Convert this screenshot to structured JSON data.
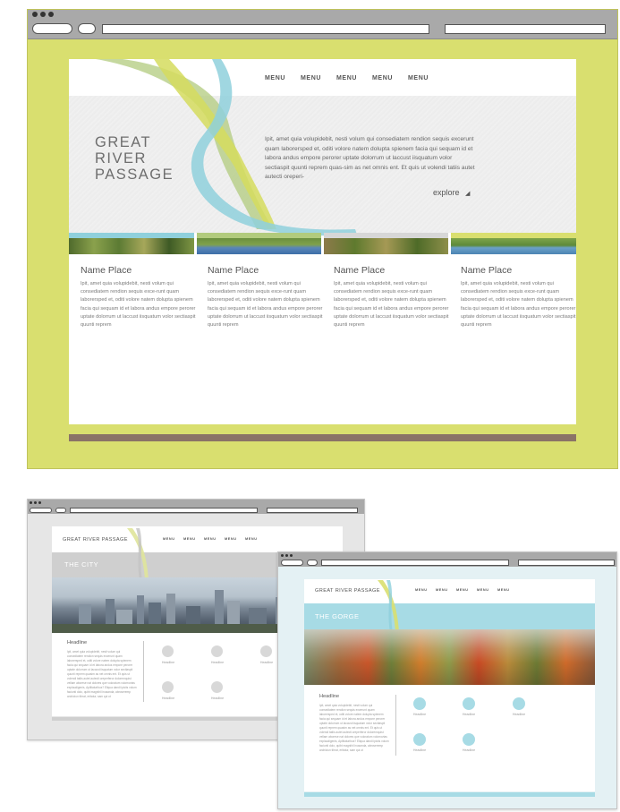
{
  "main": {
    "logo": {
      "line1": "GREAT",
      "line2": "RIVER",
      "line3": "PASSAGE"
    },
    "menu": [
      "MENU",
      "MENU",
      "MENU",
      "MENU",
      "MENU"
    ],
    "hero_text": "Ipit, amet quia volupidebit, nesti volum qui consediatem rendion sequis excerunt quam laborersped et, oditi volore natem dolupta spienem facia qui sequam id et labora andus empore perorer uptate dolorrum ut laccust iisquatum volor sectiaspit quunti reprem quas-sim as net omnis ent. Et quis ut volendi tatiis autet autecti oreperi-",
    "explore": "explore",
    "cards": [
      {
        "title": "Name Place",
        "text": "Ipit, amet quia volupidebit, nesti volum qui consediatem rendion sequis exce-runt quam laborersped et, oditi volore natem dolupta spienem facia qui sequam id et labora andus empore perorer uptate dolorrum ut laccust iisquatum volor sectiaspit quunti reprem"
      },
      {
        "title": "Name Place",
        "text": "Ipit, amet quia volupidebit, nesti volum qui consediatem rendion sequis exce-runt quam laborersped et, oditi volore natem dolupta spienem facia qui sequam id et labora andus empore perorer uptate dolorrum ut laccust iisquatum volor sectiaspit quunti reprem"
      },
      {
        "title": "Name Place",
        "text": "Ipit, amet quia volupidebit, nesti volum qui consediatem rendion sequis exce-runt quam laborersped et, oditi volore natem dolupta spienem facia qui sequam id et labora andus empore perorer uptate dolorrum ut laccust iisquatum volor sectiaspit quunti reprem"
      },
      {
        "title": "Name Place",
        "text": "Ipit, amet quia volupidebit, nesti volum qui consediatem rendion sequis exce-runt quam laborersped et, oditi volore natem dolupta spienem facia qui sequam id et labora andus empore perorer uptate dolorrum ut laccust iisquatum volor sectiaspit quunti reprem"
      }
    ]
  },
  "city": {
    "logo": "GREAT RIVER PASSAGE",
    "menu": [
      "MENU",
      "MENU",
      "MENU",
      "MENU",
      "MENU"
    ],
    "banner": "THE CITY",
    "headline": "Headline",
    "body": "Ipit, amet quia volupidebit, nesti volum qui consediatem rendion sequis excerunt quam laborersped et, oditi volore natem dolupta spienem facia qui sequam id et labora andus empore perorer uptate dolorrum ut laccust iisquatum volor sectiaspit quunti reprem quasim as net omnis ent. Et quis ut volendi tatiis autet autecti oreperferor doloremquist vellam aborese nat dolores que voloratum volorrovtas explaudigenis, Aplitiaturibus? Eliqua dandi ipiciis volum faciunti dolo, quibt magnihil inusanda, abroseremp archiciun tibrat, eritatur, sam qui ut",
    "circle_labels": [
      "Headline",
      "Headline",
      "Headline",
      "Headline",
      "Headline"
    ]
  },
  "gorge": {
    "logo": "GREAT RIVER PASSAGE",
    "menu": [
      "MENU",
      "MENU",
      "MENU",
      "MENU",
      "MENU"
    ],
    "banner": "THE GORGE",
    "headline": "Headline",
    "body": "Ipit, amet quia volupidebit, nesti volum qui consediatem rendion sequis excerunt quam laborersped et, oditi volore natem dolupta spienem facia qui sequam id et labora andus empore perorer uptate dolorrum ut laccust iisquatum volor sectiaspit quunti reprem quasim as net omnis ent. Et quis ut volendi tatiis autet autecti oreperferor doloremquist vellam aborese nat dolores que voloratum volorrovtas explaudigenis, Aplitiaturibus? Eliqua dandi ipiciis volum faciunti dolo, quibt magnihil inusanda, abroseremp archiciun tibrat, eritatur, sam qui ut",
    "circle_labels": [
      "Headline",
      "Headline",
      "Headline",
      "Headline",
      "Headline"
    ]
  },
  "colors": {
    "frame_yellow": "#d9df6f",
    "river_blue": "#8fd0dc",
    "river_green": "#b2cb7d",
    "footer_brown": "#8a7367",
    "city_gray": "#cfcfcf",
    "gorge_blue": "#a7dbe5"
  },
  "icons": [
    "window-dots-icon",
    "address-bar",
    "search-bar",
    "explore-arrow-icon"
  ]
}
